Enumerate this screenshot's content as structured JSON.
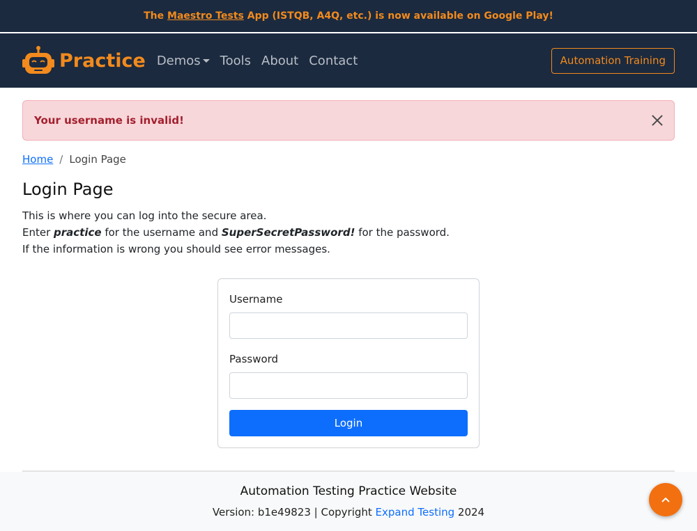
{
  "promo": {
    "prefix": "The ",
    "link_text": "Maestro Tests",
    "suffix": " App (ISTQB, A4Q, etc.) is now available on Google Play!"
  },
  "navbar": {
    "brand": "Practice",
    "links": [
      "Demos",
      "Tools",
      "About",
      "Contact"
    ],
    "training_button": "Automation Training",
    "logo_icon": "robot-icon"
  },
  "alert": {
    "message": "Your username is invalid!",
    "close_icon": "close-icon"
  },
  "breadcrumb": {
    "home": "Home",
    "separator": "/",
    "current": "Login Page"
  },
  "page": {
    "title": "Login Page",
    "line1": "This is where you can log into the secure area.",
    "line2_prefix": "Enter ",
    "username_hint": "practice",
    "line2_middle": " for the username and ",
    "password_hint": "SuperSecretPassword!",
    "line2_suffix": " for the password.",
    "line3": "If the information is wrong you should see error messages."
  },
  "form": {
    "username_label": "Username",
    "username_value": "",
    "password_label": "Password",
    "password_value": "",
    "submit_label": "Login"
  },
  "footer": {
    "title": "Automation Testing Practice Website",
    "version_prefix": "Version: b1e49823 | Copyright ",
    "company": "Expand Testing",
    "year": " 2024",
    "scroll_icon": "chevron-up-icon"
  },
  "colors": {
    "brand_orange": "#f28a1d",
    "navbar_bg": "#1b2a3f",
    "primary_blue": "#0d6efd",
    "alert_bg": "#f8d7da",
    "alert_text": "#a4202e",
    "scroll_button": "#f2700f"
  }
}
